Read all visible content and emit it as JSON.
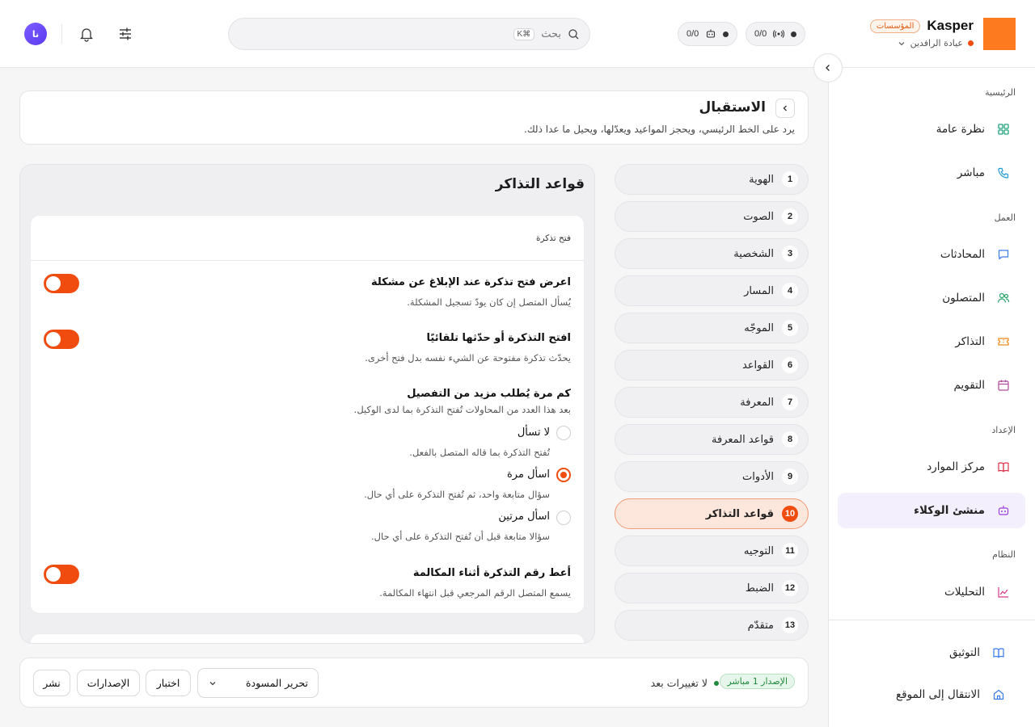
{
  "header": {
    "brand": "Kasper",
    "org_badge": "المؤسسات",
    "clinic": "عيادة الرافدين",
    "counter_calls": "0/0",
    "counter_agents": "0/0",
    "search_placeholder": "بحث",
    "search_shortcut": "⌘K",
    "avatar_initials": "نا"
  },
  "sidebar": {
    "sections": [
      {
        "label": "الرئيسية"
      },
      {
        "label": "العمل"
      },
      {
        "label": "الإعداد"
      },
      {
        "label": "النظام"
      }
    ],
    "items": [
      {
        "label": "نظرة عامة",
        "icon": "grid-icon"
      },
      {
        "label": "مباشر",
        "icon": "phone-icon"
      },
      {
        "label": "المحادثات",
        "icon": "chat-icon"
      },
      {
        "label": "المتصلون",
        "icon": "users-icon"
      },
      {
        "label": "التذاكر",
        "icon": "ticket-icon"
      },
      {
        "label": "التقويم",
        "icon": "calendar-icon"
      },
      {
        "label": "مركز الموارد",
        "icon": "book-icon"
      },
      {
        "label": "منشئ الوكلاء",
        "icon": "robot-icon"
      },
      {
        "label": "التحليلات",
        "icon": "chart-icon"
      }
    ],
    "footer": [
      {
        "label": "التوثيق",
        "icon": "docs-icon"
      },
      {
        "label": "الانتقال إلى الموقع",
        "icon": "home-icon"
      }
    ]
  },
  "page": {
    "title": "الاستقبال",
    "subtitle": "يرد على الخط الرئيسي، ويحجز المواعيد ويعدّلها، ويحيل ما عدا ذلك."
  },
  "steps": [
    {
      "num": "1",
      "label": "الهوية"
    },
    {
      "num": "2",
      "label": "الصوت"
    },
    {
      "num": "3",
      "label": "الشخصية"
    },
    {
      "num": "4",
      "label": "المسار"
    },
    {
      "num": "5",
      "label": "الموجّه"
    },
    {
      "num": "6",
      "label": "القواعد"
    },
    {
      "num": "7",
      "label": "المعرفة"
    },
    {
      "num": "8",
      "label": "قواعد المعرفة"
    },
    {
      "num": "9",
      "label": "الأدوات"
    },
    {
      "num": "10",
      "label": "قواعد التذاكر"
    },
    {
      "num": "11",
      "label": "التوجيه"
    },
    {
      "num": "12",
      "label": "الضبط"
    },
    {
      "num": "13",
      "label": "متقدّم"
    }
  ],
  "panel": {
    "title": "قواعد التذاكر",
    "card_head": "فتح تذكرة",
    "rules": [
      {
        "title": "اعرض فتح تذكرة عند الإبلاغ عن مشكلة",
        "desc": "يُسأل المتصل إن كان يودّ تسجيل المشكلة.",
        "enabled": true
      },
      {
        "title": "افتح التذكرة أو حدّثها تلقائيًا",
        "desc": "يحدّث تذكرة مفتوحة عن الشيء نفسه بدل فتح أخرى.",
        "enabled": true
      },
      {
        "title": "أعط رقم التذكرة أثناء المكالمة",
        "desc": "يسمع المتصل الرقم المرجعي قبل انتهاء المكالمة.",
        "enabled": true
      }
    ],
    "detail_question": {
      "title": "كم مرة يُطلب مزيد من التفصيل",
      "desc": "بعد هذا العدد من المحاولات تُفتح التذكرة بما لدى الوكيل.",
      "options": [
        {
          "label": "لا تسأل",
          "desc": "تُفتح التذكرة بما قاله المتصل بالفعل.",
          "selected": false
        },
        {
          "label": "اسأل مرة",
          "desc": "سؤال متابعة واحد، ثم تُفتح التذكرة على أي حال.",
          "selected": true
        },
        {
          "label": "اسأل مرتين",
          "desc": "سؤالا متابعة قبل أن تُفتح التذكرة على أي حال.",
          "selected": false
        }
      ]
    }
  },
  "footer_bar": {
    "version_badge": "الإصدار 1 مباشر",
    "status": "لا تغييرات بعد",
    "select_value": "تحرير المسودة",
    "test_label": "اختبار",
    "versions_label": "الإصدارات",
    "publish_label": "نشر"
  },
  "colors": {
    "accent": "#f04c10",
    "logo": "#fd7a1f",
    "active_nav_bg": "#f3effc",
    "live_green": "#1f8a3b"
  }
}
